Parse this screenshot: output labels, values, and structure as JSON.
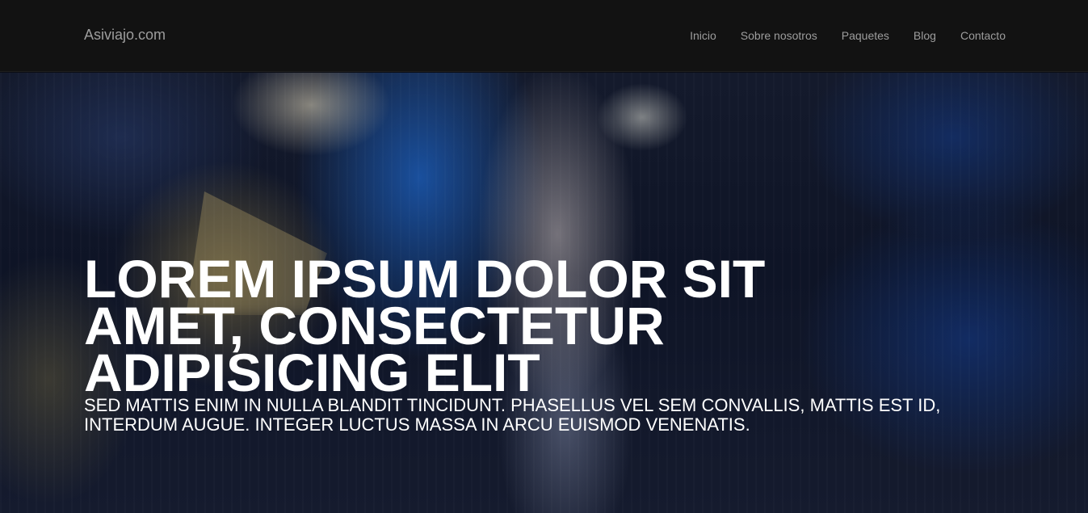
{
  "navbar": {
    "brand": "Asiviajo.com",
    "links": [
      "Inicio",
      "Sobre nosotros",
      "Paquetes",
      "Blog",
      "Contacto"
    ]
  },
  "hero": {
    "title": "LOREM IPSUM DOLOR SIT AMET, CONSECTETUR ADIPISICING ELIT",
    "subtitle": "SED MATTIS ENIM IN NULLA BLANDIT TINCIDUNT. PHASELLUS VEL SEM CONVALLIS, MATTIS EST ID, INTERDUM AUGUE. INTEGER LUCTUS MASSA IN ARCU EUISMOD VENENATIS."
  },
  "colors": {
    "navbar_bg": "#121212",
    "nav_text": "#9d9d9d",
    "hero_text": "#ffffff"
  }
}
